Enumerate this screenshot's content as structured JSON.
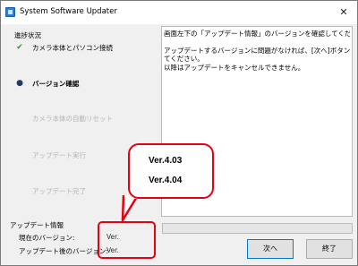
{
  "window": {
    "title": "System Software Updater",
    "close_glyph": "✕"
  },
  "steps_panel": {
    "heading": "進捗状況",
    "steps": [
      {
        "label": "カメラ本体とパソコン接続",
        "status": "done",
        "mark": "✔"
      },
      {
        "label": "バージョン確認",
        "status": "current",
        "mark": "●"
      },
      {
        "label": "カメラ本体の自動リセット",
        "status": "pending",
        "mark": ""
      },
      {
        "label": "アップデート実行",
        "status": "pending",
        "mark": ""
      },
      {
        "label": "アップデート完了",
        "status": "pending",
        "mark": ""
      }
    ]
  },
  "message": {
    "line1": "画面左下の「アップデート情報」のバージョンを確認してください。",
    "line2": "アップデートするバージョンに問題がなければ、[次へ]ボタンを押し",
    "line3": "てください。",
    "line4": "以降はアップデートをキャンセルできません。"
  },
  "update_info": {
    "heading": "アップデート情報",
    "current_version_label": "現在のバージョン:",
    "current_version_value": "Ver.",
    "new_version_label": "アップデート後のバージョン:",
    "new_version_value": "Ver."
  },
  "progress": {
    "percent": 0
  },
  "buttons": {
    "next": "次へ",
    "finish": "終了"
  },
  "callout": {
    "current_version": "Ver.4.03",
    "new_version": "Ver.4.04"
  },
  "colors": {
    "accent_red": "#e60012",
    "check_green": "#2c9b2c"
  }
}
